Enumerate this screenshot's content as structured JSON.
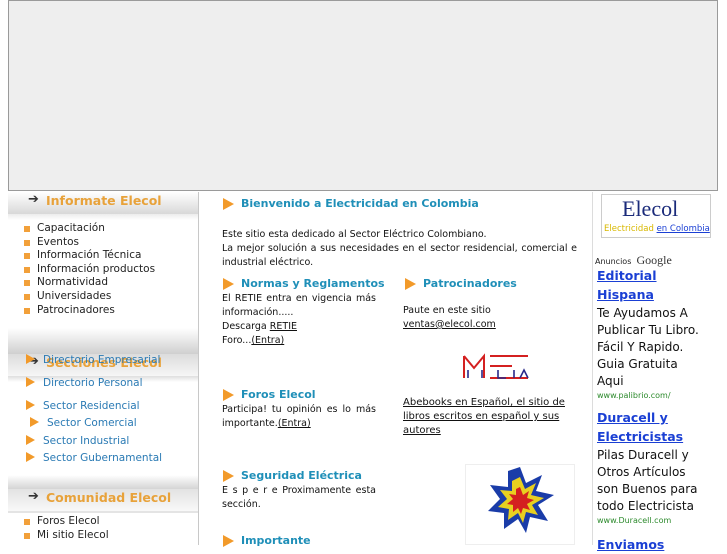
{
  "sidebar": {
    "informate": {
      "title": "Informate Elecol",
      "items": [
        "Capacitación",
        "Eventos",
        "Información Técnica",
        "Información productos",
        "Normatividad",
        "Universidades",
        "Patrocinadores"
      ]
    },
    "secciones": {
      "title": "Secciones  Elecol",
      "items": [
        "Directorio Empresarial",
        "Directorio Personal",
        "Sector Residencial",
        "Sector Comercial",
        "Sector Industrial",
        "Sector Gubernamental"
      ]
    },
    "comunidad": {
      "title": "Comunidad Elecol",
      "items": [
        "Foros Elecol",
        "Mi sitio Elecol"
      ]
    },
    "arrow": "➔"
  },
  "main": {
    "welcome_title": "Bienvenido a Electricidad en Colombia",
    "welcome_text_1": "Este sitio esta dedicado al Sector Eléctrico Colombiano.",
    "welcome_text_2": "La mejor solución a sus necesidades en el sector residencial, comercial e industrial eléctrico.",
    "normas_title": "Normas y Reglamentos",
    "normas_text": "El RETIE entra en vigencia más información.....",
    "normas_descarga": "Descarga",
    "normas_retie_link": "RETIE",
    "normas_foro": "Foro...",
    "normas_entra": "(Entra)",
    "patro_title": "Patrocinadores",
    "patro_text": "Paute en este sitio",
    "patro_email": "ventas@elecol.com",
    "meltda_logo": "MELTDA",
    "abebooks_link": "Abebooks en Español, el sitio de libros escritos en español y sus autores",
    "foros_title": "Foros Elecol",
    "foros_text": "Participa! tu opinión es lo más importante.",
    "foros_entra": "(Entra)",
    "seguridad_title": "Seguridad Eléctrica",
    "seguridad_text": "E s p e r e Proximamente esta sección.",
    "importante_title": "Importante"
  },
  "right": {
    "logo_title": "Elecol",
    "logo_sub_1": "Electricidad",
    "logo_sub_2": "en Colombia",
    "ads_label": "Anuncios",
    "ads_google": "Google",
    "ads": [
      {
        "title_1": "Editorial",
        "title_2": "Hispana",
        "lines": [
          "Te Ayudamos A",
          "Publicar Tu Libro.",
          "Fácil Y Rapido.",
          "Guia Gratuita",
          "Aqui"
        ],
        "url": "www.palibrio.com/"
      },
      {
        "title_1": "Duracell y",
        "title_2": "Electricistas",
        "lines": [
          "Pilas Duracell y",
          "Otros Artículos",
          "son Buenos para",
          "todo Electricista"
        ],
        "url": "www.Duracell.com"
      },
      {
        "title_1": "Enviamos",
        "title_2": "",
        "lines": [],
        "url": ""
      }
    ]
  },
  "colors": {
    "accent_orange": "#f29a2a",
    "title_blue": "#1f8fb8",
    "link_blue": "#2a7ab4",
    "ad_blue": "#1a3fd4",
    "ad_green": "#2c8a2c"
  }
}
